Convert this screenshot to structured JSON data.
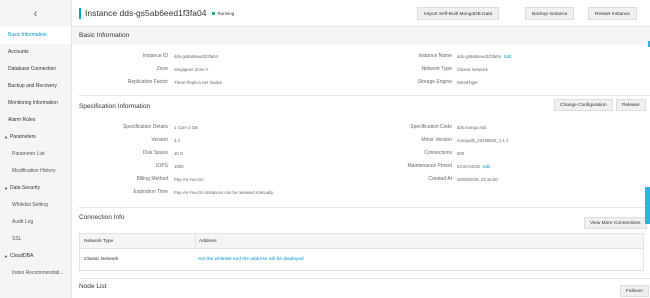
{
  "sidebar": {
    "back_icon": "chevron-left-icon",
    "back_glyph": "‹",
    "items": [
      {
        "label": "Basic Information"
      },
      {
        "label": "Accounts"
      },
      {
        "label": "Database Connection"
      },
      {
        "label": "Backup and Recovery"
      },
      {
        "label": "Monitoring Information"
      },
      {
        "label": "Alarm Rules"
      }
    ],
    "groups": [
      {
        "label": "Parameters",
        "items": [
          "Parameter List",
          "Modification History"
        ]
      },
      {
        "label": "Data Security",
        "items": [
          "Whitelist Setting",
          "Audit Log",
          "SSL"
        ]
      },
      {
        "label": "CloudDBA",
        "items": [
          "Index Recommendati..."
        ]
      }
    ]
  },
  "header": {
    "title": "Instance dds-gs5ab6eed1f3fa04",
    "status": "Running",
    "status_color": "#1fb16b",
    "buttons": [
      "Import Self-Built MongoDB Data",
      "Backup Instance",
      "Restart Instance"
    ]
  },
  "basic_info": {
    "title": "Basic Information",
    "left": [
      {
        "label": "Instance ID",
        "value": "dds-gs5ab6eed1f3fa04"
      },
      {
        "label": "Zone",
        "value": "Singapore Zone A"
      },
      {
        "label": "Replication Factor",
        "value": "Three Replica Set Nodes"
      }
    ],
    "right": [
      {
        "label": "Instance Name",
        "value": "dds-gs5ab6eed1f3fa04",
        "link": "Edit"
      },
      {
        "label": "Network Type",
        "value": "Classic Network"
      },
      {
        "label": "Storage Engine",
        "value": "WiredTiger"
      }
    ]
  },
  "spec_info": {
    "title": "Specification Information",
    "buttons": [
      "Change Configuration",
      "Release"
    ],
    "left": [
      {
        "label": "Specification Details",
        "value": "1 Core 2 GB"
      },
      {
        "label": "Version",
        "value": "3.4"
      },
      {
        "label": "Disk Space",
        "value": "10 G"
      },
      {
        "label": "IOPS",
        "value": "1000"
      },
      {
        "label": "Billing Method",
        "value": "Pay-As-You-Go"
      },
      {
        "label": "Expiration Time",
        "value": "Pay-As-You-Go instances can be released manually."
      }
    ],
    "right": [
      {
        "label": "Specification Code",
        "value": "dds.mongo.mid"
      },
      {
        "label": "Minor Version",
        "value": "mongodb_20180603_1.1.4"
      },
      {
        "label": "Connections",
        "value": "500"
      },
      {
        "label": "Maintenance Period",
        "value": "23:00-03:00",
        "link": "Edit"
      },
      {
        "label": "Created At",
        "value": "09/09/2018, 23:16:00"
      }
    ]
  },
  "connection_info": {
    "title": "Connection Info",
    "button": "View More Connections",
    "columns": [
      "Network Type",
      "Address"
    ],
    "rows": [
      {
        "network_type": "Classic Network",
        "address": "Set the whitelist and the address will be displayed"
      }
    ]
  },
  "node_list": {
    "title": "Node List",
    "button": "Failover"
  },
  "colors": {
    "accent": "#0099cc",
    "title_bar": "#00a2ca",
    "scroll_tab": "#2ab3e4"
  }
}
